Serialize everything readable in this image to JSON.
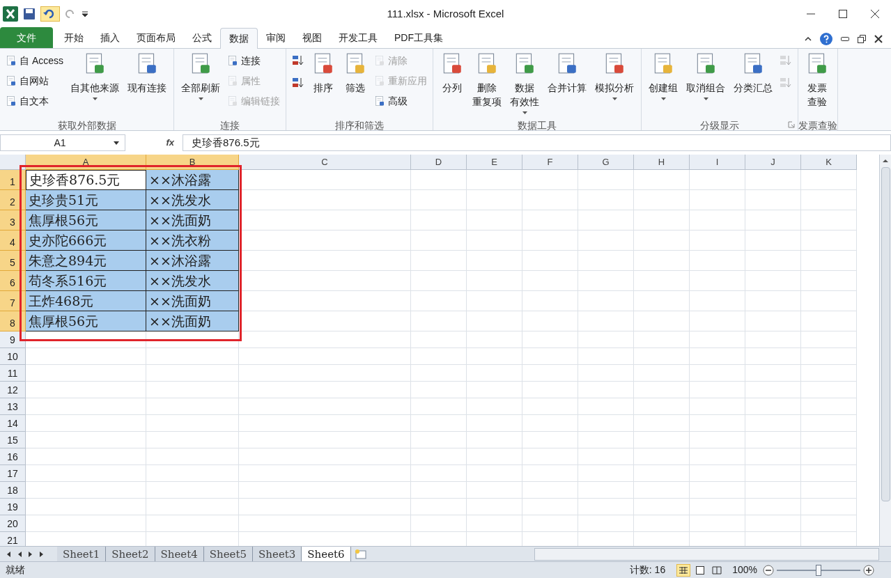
{
  "window": {
    "title": "111.xlsx - Microsoft Excel"
  },
  "tabs": [
    {
      "label": "文件",
      "kind": "file",
      "selected": false
    },
    {
      "label": "开始",
      "kind": "tab",
      "selected": false
    },
    {
      "label": "插入",
      "kind": "tab",
      "selected": false
    },
    {
      "label": "页面布局",
      "kind": "tab",
      "selected": false
    },
    {
      "label": "公式",
      "kind": "tab",
      "selected": false
    },
    {
      "label": "数据",
      "kind": "tab",
      "selected": true
    },
    {
      "label": "审阅",
      "kind": "tab",
      "selected": false
    },
    {
      "label": "视图",
      "kind": "tab",
      "selected": false
    },
    {
      "label": "开发工具",
      "kind": "tab",
      "selected": false
    },
    {
      "label": "PDF工具集",
      "kind": "tab",
      "selected": false
    }
  ],
  "ribbon": [
    {
      "title": "获取外部数据",
      "launcher": false,
      "columns": [
        {
          "kind": "small",
          "items": [
            {
              "label": "自 Access",
              "disabled": false
            },
            {
              "label": "自网站",
              "disabled": false
            },
            {
              "label": "自文本",
              "disabled": false
            }
          ]
        },
        {
          "kind": "large",
          "label": "自其他来源",
          "dropdown": true,
          "disabled": false
        },
        {
          "kind": "large",
          "label": "现有连接",
          "dropdown": false,
          "disabled": false
        }
      ]
    },
    {
      "title": "连接",
      "launcher": false,
      "columns": [
        {
          "kind": "large",
          "label": "全部刷新",
          "dropdown": true,
          "disabled": false
        },
        {
          "kind": "small",
          "items": [
            {
              "label": "连接",
              "disabled": false
            },
            {
              "label": "属性",
              "disabled": true
            },
            {
              "label": "编辑链接",
              "disabled": true
            }
          ]
        }
      ]
    },
    {
      "title": "排序和筛选",
      "launcher": false,
      "columns": [
        {
          "kind": "icons",
          "count_disabled": [
            false,
            false
          ]
        },
        {
          "kind": "large",
          "label": "排序",
          "dropdown": false,
          "disabled": false
        },
        {
          "kind": "large",
          "label": "筛选",
          "dropdown": false,
          "disabled": false
        },
        {
          "kind": "small",
          "items": [
            {
              "label": "清除",
              "disabled": true
            },
            {
              "label": "重新应用",
              "disabled": true
            },
            {
              "label": "高级",
              "disabled": false
            }
          ]
        }
      ]
    },
    {
      "title": "数据工具",
      "launcher": false,
      "columns": [
        {
          "kind": "large",
          "label": "分列",
          "dropdown": false,
          "disabled": false
        },
        {
          "kind": "large",
          "label": [
            "删除",
            "重复项"
          ],
          "dropdown": false,
          "disabled": false
        },
        {
          "kind": "large",
          "label": [
            "数据",
            "有效性"
          ],
          "dropdown": true,
          "disabled": false
        },
        {
          "kind": "large",
          "label": "合并计算",
          "dropdown": false,
          "disabled": false
        },
        {
          "kind": "large",
          "label": "模拟分析",
          "dropdown": true,
          "disabled": false
        }
      ]
    },
    {
      "title": "分级显示",
      "launcher": true,
      "columns": [
        {
          "kind": "large",
          "label": "创建组",
          "dropdown": true,
          "disabled": false
        },
        {
          "kind": "large",
          "label": "取消组合",
          "dropdown": true,
          "disabled": false
        },
        {
          "kind": "large",
          "label": "分类汇总",
          "dropdown": false,
          "disabled": false
        },
        {
          "kind": "icons",
          "count_disabled": [
            true,
            true
          ]
        }
      ]
    },
    {
      "title": "发票查验",
      "launcher": false,
      "columns": [
        {
          "kind": "large",
          "label": [
            "发票",
            "查验"
          ],
          "dropdown": false,
          "disabled": false
        }
      ]
    }
  ],
  "formula_bar": {
    "name_box": "A1",
    "fx": "fx",
    "value": "史珍香876.5元"
  },
  "columns": [
    {
      "label": "A",
      "selected": true
    },
    {
      "label": "B",
      "selected": true
    },
    {
      "label": "C",
      "selected": false
    },
    {
      "label": "D",
      "selected": false
    },
    {
      "label": "E",
      "selected": false
    },
    {
      "label": "F",
      "selected": false
    },
    {
      "label": "G",
      "selected": false
    },
    {
      "label": "H",
      "selected": false
    },
    {
      "label": "I",
      "selected": false
    },
    {
      "label": "J",
      "selected": false
    },
    {
      "label": "K",
      "selected": false
    }
  ],
  "rows": [
    {
      "header": "1",
      "selected": true,
      "cells": [
        {
          "text": "史珍香876.5元",
          "active": true
        },
        {
          "text": "××沐浴露",
          "active": false
        }
      ]
    },
    {
      "header": "2",
      "selected": true,
      "cells": [
        {
          "text": "史珍贵51元",
          "active": false
        },
        {
          "text": "××洗发水",
          "active": false
        }
      ]
    },
    {
      "header": "3",
      "selected": true,
      "cells": [
        {
          "text": "焦厚根56元",
          "active": false
        },
        {
          "text": "××洗面奶",
          "active": false
        }
      ]
    },
    {
      "header": "4",
      "selected": true,
      "cells": [
        {
          "text": "史亦陀666元",
          "active": false
        },
        {
          "text": "××洗衣粉",
          "active": false
        }
      ]
    },
    {
      "header": "5",
      "selected": true,
      "cells": [
        {
          "text": "朱意之894元",
          "active": false
        },
        {
          "text": "××沐浴露",
          "active": false
        }
      ]
    },
    {
      "header": "6",
      "selected": true,
      "cells": [
        {
          "text": "苟冬系516元",
          "active": false
        },
        {
          "text": "××洗发水",
          "active": false
        }
      ]
    },
    {
      "header": "7",
      "selected": true,
      "cells": [
        {
          "text": "王炸468元",
          "active": false
        },
        {
          "text": "××洗面奶",
          "active": false
        }
      ]
    },
    {
      "header": "8",
      "selected": true,
      "cells": [
        {
          "text": "焦厚根56元",
          "active": false
        },
        {
          "text": "××洗面奶",
          "active": false
        }
      ]
    },
    {
      "header": "9",
      "selected": false,
      "cells": []
    },
    {
      "header": "10",
      "selected": false,
      "cells": []
    },
    {
      "header": "11",
      "selected": false,
      "cells": []
    },
    {
      "header": "12",
      "selected": false,
      "cells": []
    },
    {
      "header": "13",
      "selected": false,
      "cells": []
    },
    {
      "header": "14",
      "selected": false,
      "cells": []
    },
    {
      "header": "15",
      "selected": false,
      "cells": []
    },
    {
      "header": "16",
      "selected": false,
      "cells": []
    },
    {
      "header": "17",
      "selected": false,
      "cells": []
    },
    {
      "header": "18",
      "selected": false,
      "cells": []
    },
    {
      "header": "19",
      "selected": false,
      "cells": []
    },
    {
      "header": "20",
      "selected": false,
      "cells": []
    },
    {
      "header": "21",
      "selected": false,
      "cells": []
    }
  ],
  "highlight_frame": true,
  "sheets": [
    {
      "label": "Sheet1",
      "selected": false
    },
    {
      "label": "Sheet2",
      "selected": false
    },
    {
      "label": "Sheet4",
      "selected": false
    },
    {
      "label": "Sheet5",
      "selected": false
    },
    {
      "label": "Sheet3",
      "selected": false
    },
    {
      "label": "Sheet6",
      "selected": true
    }
  ],
  "status_bar": {
    "status": "就绪",
    "count": "计数: 16",
    "zoom": "100%",
    "zoom_slider": {
      "level": 0.5
    }
  }
}
